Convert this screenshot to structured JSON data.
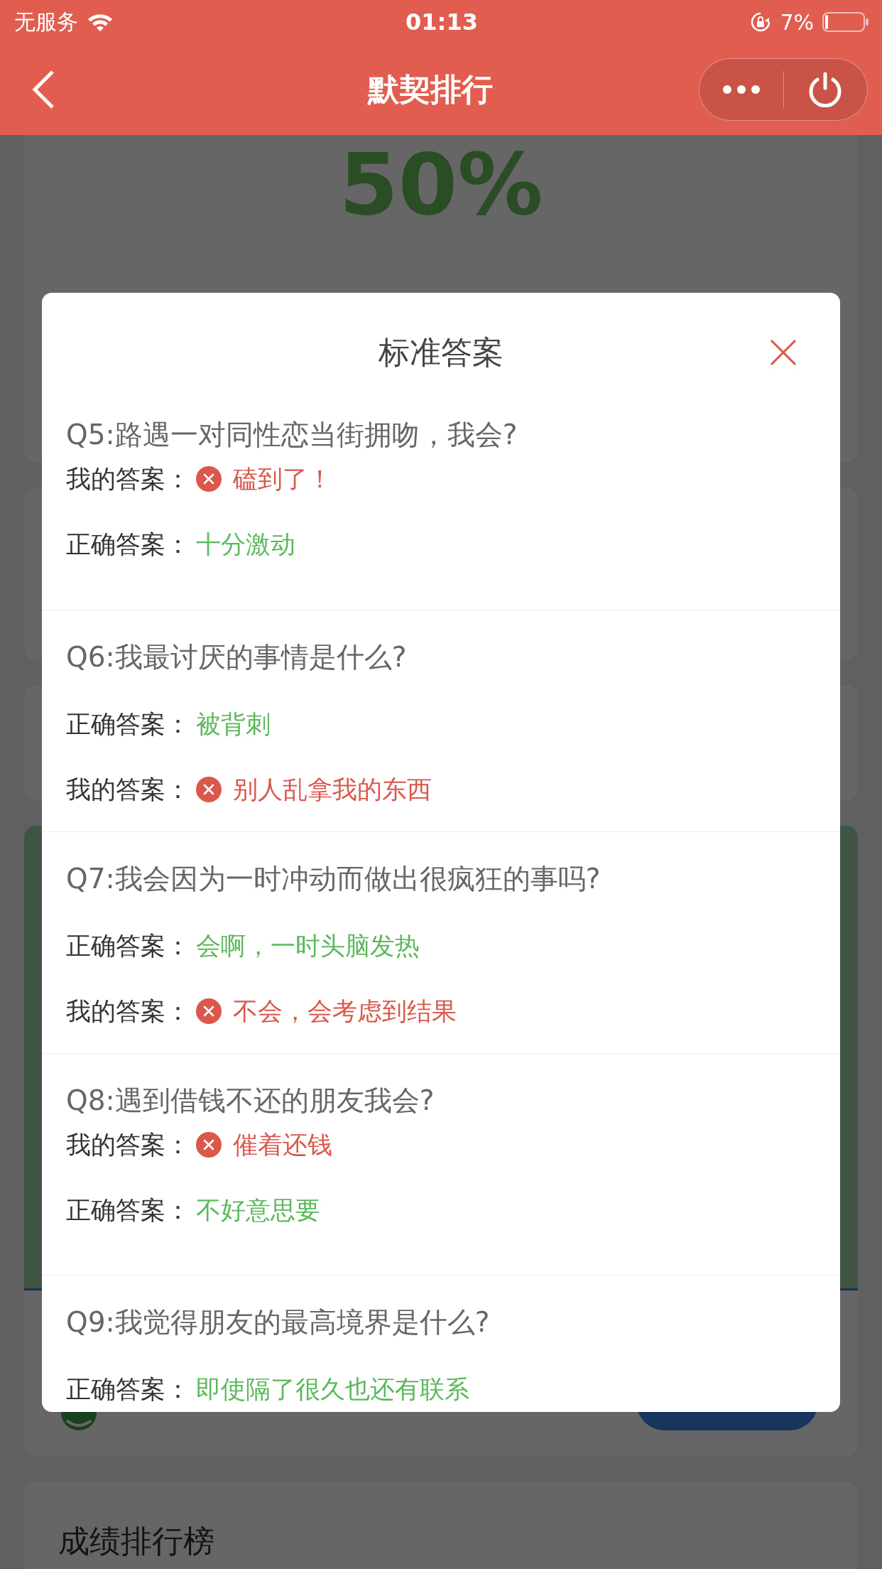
{
  "status_bar": {
    "carrier": "无服务",
    "time": "01:13",
    "battery": "7%"
  },
  "nav": {
    "title": "默契排行"
  },
  "score": {
    "percent": "50%"
  },
  "ranking": {
    "title": "成绩排行榜"
  },
  "modal": {
    "title": "标准答案",
    "questions": [
      {
        "question": "Q5:路遇一对同性恋当街拥吻，我会?",
        "answers": [
          {
            "kind": "mine",
            "label": "我的答案：",
            "text": "磕到了！"
          },
          {
            "kind": "correct",
            "label": "正确答案：",
            "text": "十分激动"
          }
        ]
      },
      {
        "question": "Q6:我最讨厌的事情是什么?",
        "answers": [
          {
            "kind": "correct",
            "label": "正确答案：",
            "text": "被背刺"
          },
          {
            "kind": "mine",
            "label": "我的答案：",
            "text": "别人乱拿我的东西"
          }
        ]
      },
      {
        "question": "Q7:我会因为一时冲动而做出很疯狂的事吗?",
        "answers": [
          {
            "kind": "correct",
            "label": "正确答案：",
            "text": "会啊，一时头脑发热"
          },
          {
            "kind": "mine",
            "label": "我的答案：",
            "text": "不会，会考虑到结果"
          }
        ]
      },
      {
        "question": "Q8:遇到借钱不还的朋友我会?",
        "answers": [
          {
            "kind": "mine",
            "label": "我的答案：",
            "text": "催着还钱"
          },
          {
            "kind": "correct",
            "label": "正确答案：",
            "text": "不好意思要"
          }
        ]
      },
      {
        "question": "Q9:我觉得朋友的最高境界是什么?",
        "answers": [
          {
            "kind": "correct",
            "label": "正确答案：",
            "text": "即使隔了很久也还有联系"
          }
        ]
      }
    ]
  }
}
